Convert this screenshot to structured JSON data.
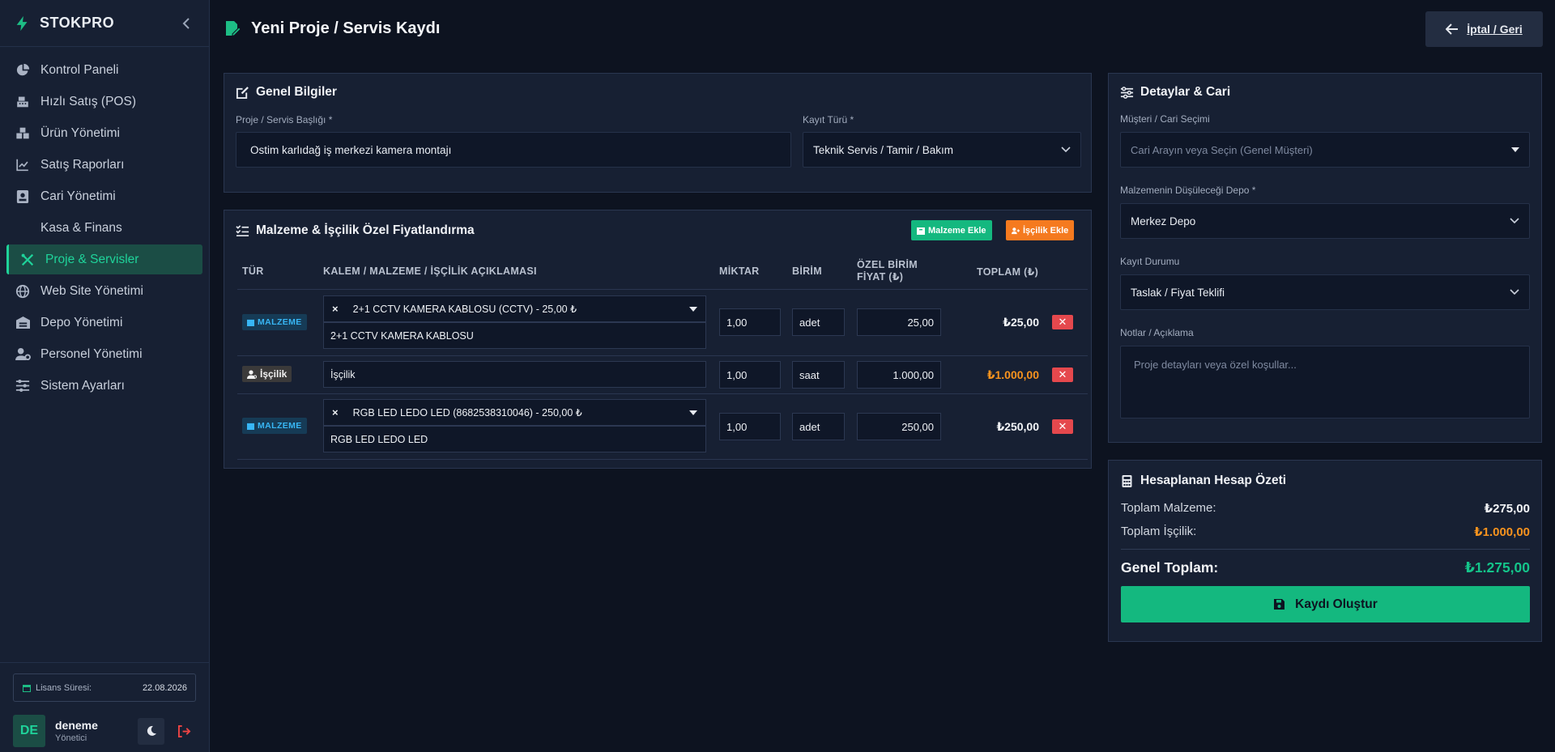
{
  "brand": {
    "name": "STOKPRO"
  },
  "sidebar": {
    "items": [
      {
        "label": "Kontrol Paneli",
        "icon": "pie-chart-icon"
      },
      {
        "label": "Hızlı Satış (POS)",
        "icon": "cash-register-icon"
      },
      {
        "label": "Ürün Yönetimi",
        "icon": "boxes-icon"
      },
      {
        "label": "Satış Raporları",
        "icon": "line-chart-icon"
      },
      {
        "label": "Cari Yönetimi",
        "icon": "contact-card-icon"
      },
      {
        "label": "Kasa & Finans",
        "icon": "wallet-icon"
      },
      {
        "label": "Proje & Servisler",
        "icon": "tools-icon",
        "active": true
      },
      {
        "label": "Web Site Yönetimi",
        "icon": "globe-icon"
      },
      {
        "label": "Depo Yönetimi",
        "icon": "warehouse-icon"
      },
      {
        "label": "Personel Yönetimi",
        "icon": "users-gear-icon"
      },
      {
        "label": "Sistem Ayarları",
        "icon": "sliders-icon"
      }
    ],
    "license_label": "Lisans Süresi:",
    "license_date": "22.08.2026",
    "user": {
      "initials": "DE",
      "name": "deneme",
      "role": "Yönetici"
    }
  },
  "header": {
    "title": "Yeni Proje / Servis Kaydı",
    "back_label": "İptal / Geri"
  },
  "general": {
    "title": "Genel Bilgiler",
    "project_title_label": "Proje / Servis Başlığı *",
    "project_title_value": "Ostim karlıdağ iş merkezi kamera montajı",
    "record_type_label": "Kayıt Türü *",
    "record_type_value": "Teknik Servis / Tamir / Bakım"
  },
  "materials": {
    "title": "Malzeme & İşçilik Özel Fiyatlandırma",
    "add_material_label": "Malzeme Ekle",
    "add_labor_label": "İşçilik Ekle",
    "columns": [
      "TÜR",
      "KALEM / MALZEME / İŞÇİLİK AÇIKLAMASI",
      "MİKTAR",
      "BİRİM",
      "ÖZEL BİRİM",
      "FİYAT (₺)",
      "TOPLAM (₺)"
    ],
    "rows": [
      {
        "type": "MALZEME",
        "select": "2+1 CCTV KAMERA KABLOSU (CCTV) - 25,00 ₺",
        "desc": "2+1 CCTV KAMERA KABLOSU",
        "qty": "1,00",
        "unit": "adet",
        "price": "25,00",
        "total": "₺25,00"
      },
      {
        "type": "İşçilik",
        "desc": "İşçilik",
        "qty": "1,00",
        "unit": "saat",
        "price": "1.000,00",
        "total": "₺1.000,00"
      },
      {
        "type": "MALZEME",
        "select": "RGB LED LEDO LED (8682538310046) - 250,00 ₺",
        "desc": "RGB LED LEDO LED",
        "qty": "1,00",
        "unit": "adet",
        "price": "250,00",
        "total": "₺250,00"
      }
    ],
    "delete_symbol": "✕",
    "clear_symbol": "×"
  },
  "details": {
    "title": "Detaylar & Cari",
    "customer_label": "Müşteri / Cari Seçimi",
    "customer_placeholder": "Cari Arayın veya Seçin (Genel Müşteri)",
    "depot_label": "Malzemenin Düşüleceği Depo *",
    "depot_value": "Merkez Depo",
    "status_label": "Kayıt Durumu",
    "status_value": "Taslak / Fiyat Teklifi",
    "notes_label": "Notlar / Açıklama",
    "notes_placeholder": "Proje detayları veya özel koşullar..."
  },
  "summary": {
    "title": "Hesaplanan Hesap Özeti",
    "material_label": "Toplam Malzeme:",
    "material_value": "₺275,00",
    "labor_label": "Toplam İşçilik:",
    "labor_value": "₺1.000,00",
    "grand_label": "Genel Toplam:",
    "grand_value": "₺1.275,00",
    "submit_label": "Kaydı Oluştur"
  },
  "colors": {
    "accent": "#14b87f",
    "labor_orange": "#f7931e",
    "material_blue": "#38b6f5",
    "danger": "#e5484d",
    "background": "#0d1320",
    "panel": "#172033"
  }
}
